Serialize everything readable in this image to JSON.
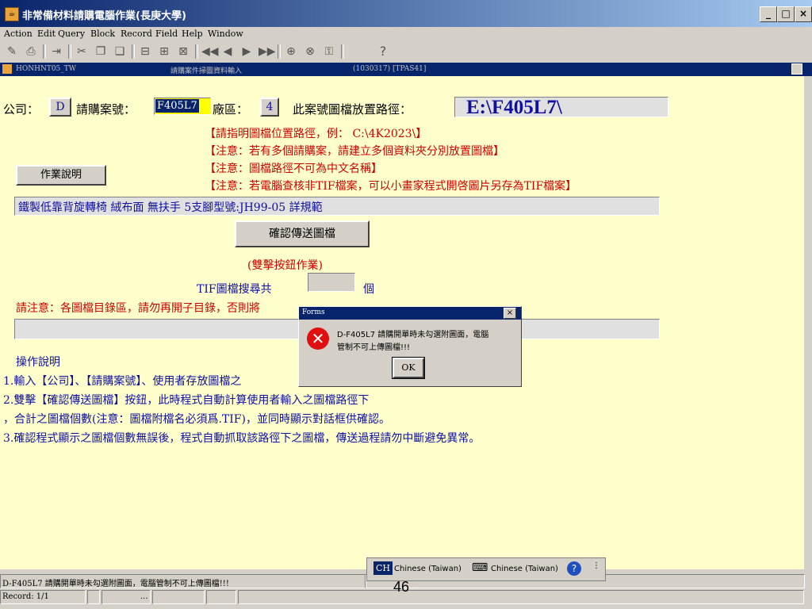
{
  "title": "非常備材料請購電腦作業(長庚大學)",
  "window_buttons": {
    "minimize": "_",
    "maximize": "□",
    "close": "×"
  },
  "menu": [
    "Action",
    "Edit",
    "Query",
    "Block",
    "Record",
    "Field",
    "Help",
    "Window"
  ],
  "toolbar_help": "?",
  "inner": {
    "form_id": "HONHNT05_TW",
    "form_title": "請購案件掃圖資料輸入",
    "info": "(1030317) [TPAS41]"
  },
  "form": {
    "company_label": "公司：",
    "company_value": "D",
    "case_label": "請購案號：",
    "case_value": "F405L7",
    "plant_label": "廠區：",
    "plant_value": "4",
    "path_label": "此案號圖檔放置路徑：",
    "path_value": "E:\\F405L7\\",
    "notes": [
      "【請指明圖檔位置路徑，例： C:\\4K2023\\】",
      "【注意：若有多個請購案，請建立多個資料夾分別放置圖檔】",
      "【注意：圖檔路徑不可為中文名稱】",
      "【注意：若電腦查核非TIF檔案，可以小畫家程式開啓圖片另存為TIF檔案】"
    ],
    "instructions_button": "作業說明",
    "item_desc": "鐵製低靠背旋轉椅 絨布面 無扶手 5支腳型號:JH99-05 詳規範",
    "confirm_button": "確認傳送圖檔",
    "double_click_note": "(雙擊按鈕作業)",
    "tif_count_label": "TIF圖檔搜尋共",
    "tif_count_value": "",
    "tif_unit": "個",
    "warning": "請注意：各圖檔目錄區，請勿再開子目錄，否則將",
    "ops_title": "操作說明",
    "ops": [
      "1.輸入【公司】、【請購案號】、使用者存放圖檔之",
      "2.雙擊【確認傳送圖檔】按鈕，此時程式自動計算使用者輸入之圖檔路徑下",
      "，合計之圖檔個數(注意：圖檔附檔名必須爲.TIF)，並同時顯示對話框供確認。",
      "3.確認程式顯示之圖檔個數無誤後，程式自動抓取該路徑下之圖檔，傳送過程請勿中斷避免異常。"
    ]
  },
  "dialog": {
    "title": "Forms",
    "message_line1": "D-F405L7 請購開單時未勾選附圖面，電腦",
    "message_line2": "管制不可上傳圖檔!!!",
    "ok": "OK"
  },
  "status": {
    "message": "D-F405L7 請購開單時未勾選附圖面，電腦管制不可上傳圖檔!!!",
    "record": "Record: 1/1",
    "dots": "...",
    "ime_ch": "CH",
    "ime1": "Chinese (Taiwan)",
    "ime2": "Chinese (Taiwan)",
    "page_num": "46"
  }
}
